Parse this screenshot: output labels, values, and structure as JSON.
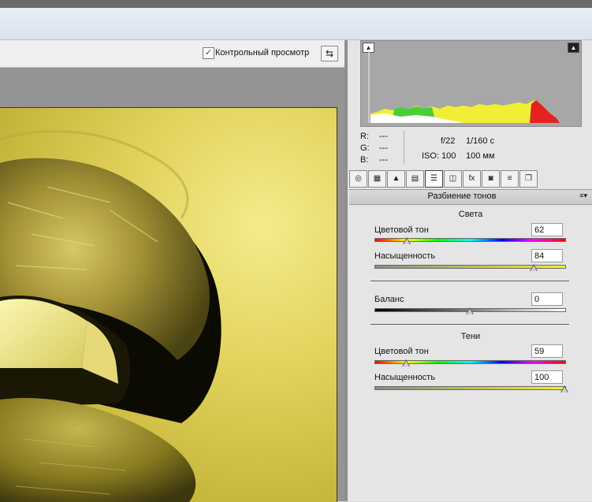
{
  "toolbar": {
    "preview_check": "✓",
    "preview_label": "Контрольный просмотр",
    "compare_icon": "⇆"
  },
  "histogram": {
    "clip_shadow_icon": "▲",
    "clip_highlight_icon": "▲"
  },
  "readout": {
    "r_label": "R:",
    "g_label": "G:",
    "b_label": "B:",
    "r_value": "---",
    "g_value": "---",
    "b_value": "---",
    "aperture": "f/22",
    "shutter": "1/160 с",
    "iso": "ISO: 100",
    "focal": "100 мм"
  },
  "tabs": [
    {
      "name": "basic-tab-icon",
      "glyph": "◎"
    },
    {
      "name": "tone-curve-tab-icon",
      "glyph": "▦"
    },
    {
      "name": "detail-tab-icon",
      "glyph": "▲"
    },
    {
      "name": "hsl-tab-icon",
      "glyph": "▤"
    },
    {
      "name": "split-toning-tab-icon",
      "glyph": "☰"
    },
    {
      "name": "lens-corrections-tab-icon",
      "glyph": "◫"
    },
    {
      "name": "effects-tab-icon",
      "glyph": "fx"
    },
    {
      "name": "camera-calibration-tab-icon",
      "glyph": "◙"
    },
    {
      "name": "presets-tab-icon",
      "glyph": "≡"
    },
    {
      "name": "snapshots-tab-icon",
      "glyph": "❐"
    }
  ],
  "panel": {
    "title": "Разбиение тонов",
    "menu_icon": "≡▾"
  },
  "highlights": {
    "title": "Света",
    "hue_label": "Цветовой тон",
    "hue_value": "62",
    "hue_fraction": 0.172,
    "sat_label": "Насыщенность",
    "sat_value": "84",
    "sat_fraction": 0.84
  },
  "balance": {
    "label": "Баланс",
    "value": "0",
    "fraction": 0.5
  },
  "shadows": {
    "title": "Тени",
    "hue_label": "Цветовой тон",
    "hue_value": "59",
    "hue_fraction": 0.164,
    "sat_label": "Насыщенность",
    "sat_value": "100",
    "sat_fraction": 1.0
  },
  "colors": {
    "tint": "#e3d45e",
    "lip": "#7d7220",
    "histo_bg": "#a7a7a7"
  }
}
